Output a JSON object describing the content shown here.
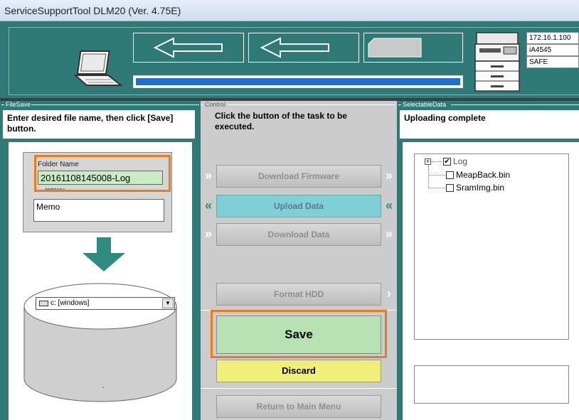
{
  "window": {
    "title": "ServiceSupportTool DLM20 (Ver. 4.75E)"
  },
  "header": {
    "progress_fraction": 1.0,
    "device": {
      "ip": "172.16.1.100",
      "model": "iA4545",
      "mode": "SAFE"
    }
  },
  "file_save": {
    "group_label": "FileSave",
    "instruction": "Enter desired file name, then click [Save] button.",
    "folder_name_label": "Folder Name",
    "folder_name_value": "20161108145008-Log",
    "memo_label": "Memo",
    "memo_value": "Memo",
    "drive_selected": "c: [windows]"
  },
  "control": {
    "group_label": "Control",
    "instruction": "Click the button of the task to be executed.",
    "buttons": {
      "download_firmware": "Download Firmware",
      "upload_data": "Upload Data",
      "download_data": "Download Data",
      "format_hdd": "Format HDD",
      "save": "Save",
      "discard": "Discard",
      "return": "Return to Main Menu"
    }
  },
  "selectable": {
    "group_label": "SelectableData",
    "status": "Uploading complete",
    "tree": [
      {
        "label": "Log",
        "checked": true
      },
      {
        "label": "MeapBack.bin",
        "checked": false
      },
      {
        "label": "SramImg.bin",
        "checked": false
      }
    ]
  },
  "colors": {
    "panel_teal": "#2f7a76",
    "highlight_orange": "#ee7a1a",
    "save_green": "#b7e2b4",
    "discard_yellow": "#f0ef7a",
    "upload_cyan": "#7fd0d6",
    "progress_blue": "#1e6fce"
  }
}
